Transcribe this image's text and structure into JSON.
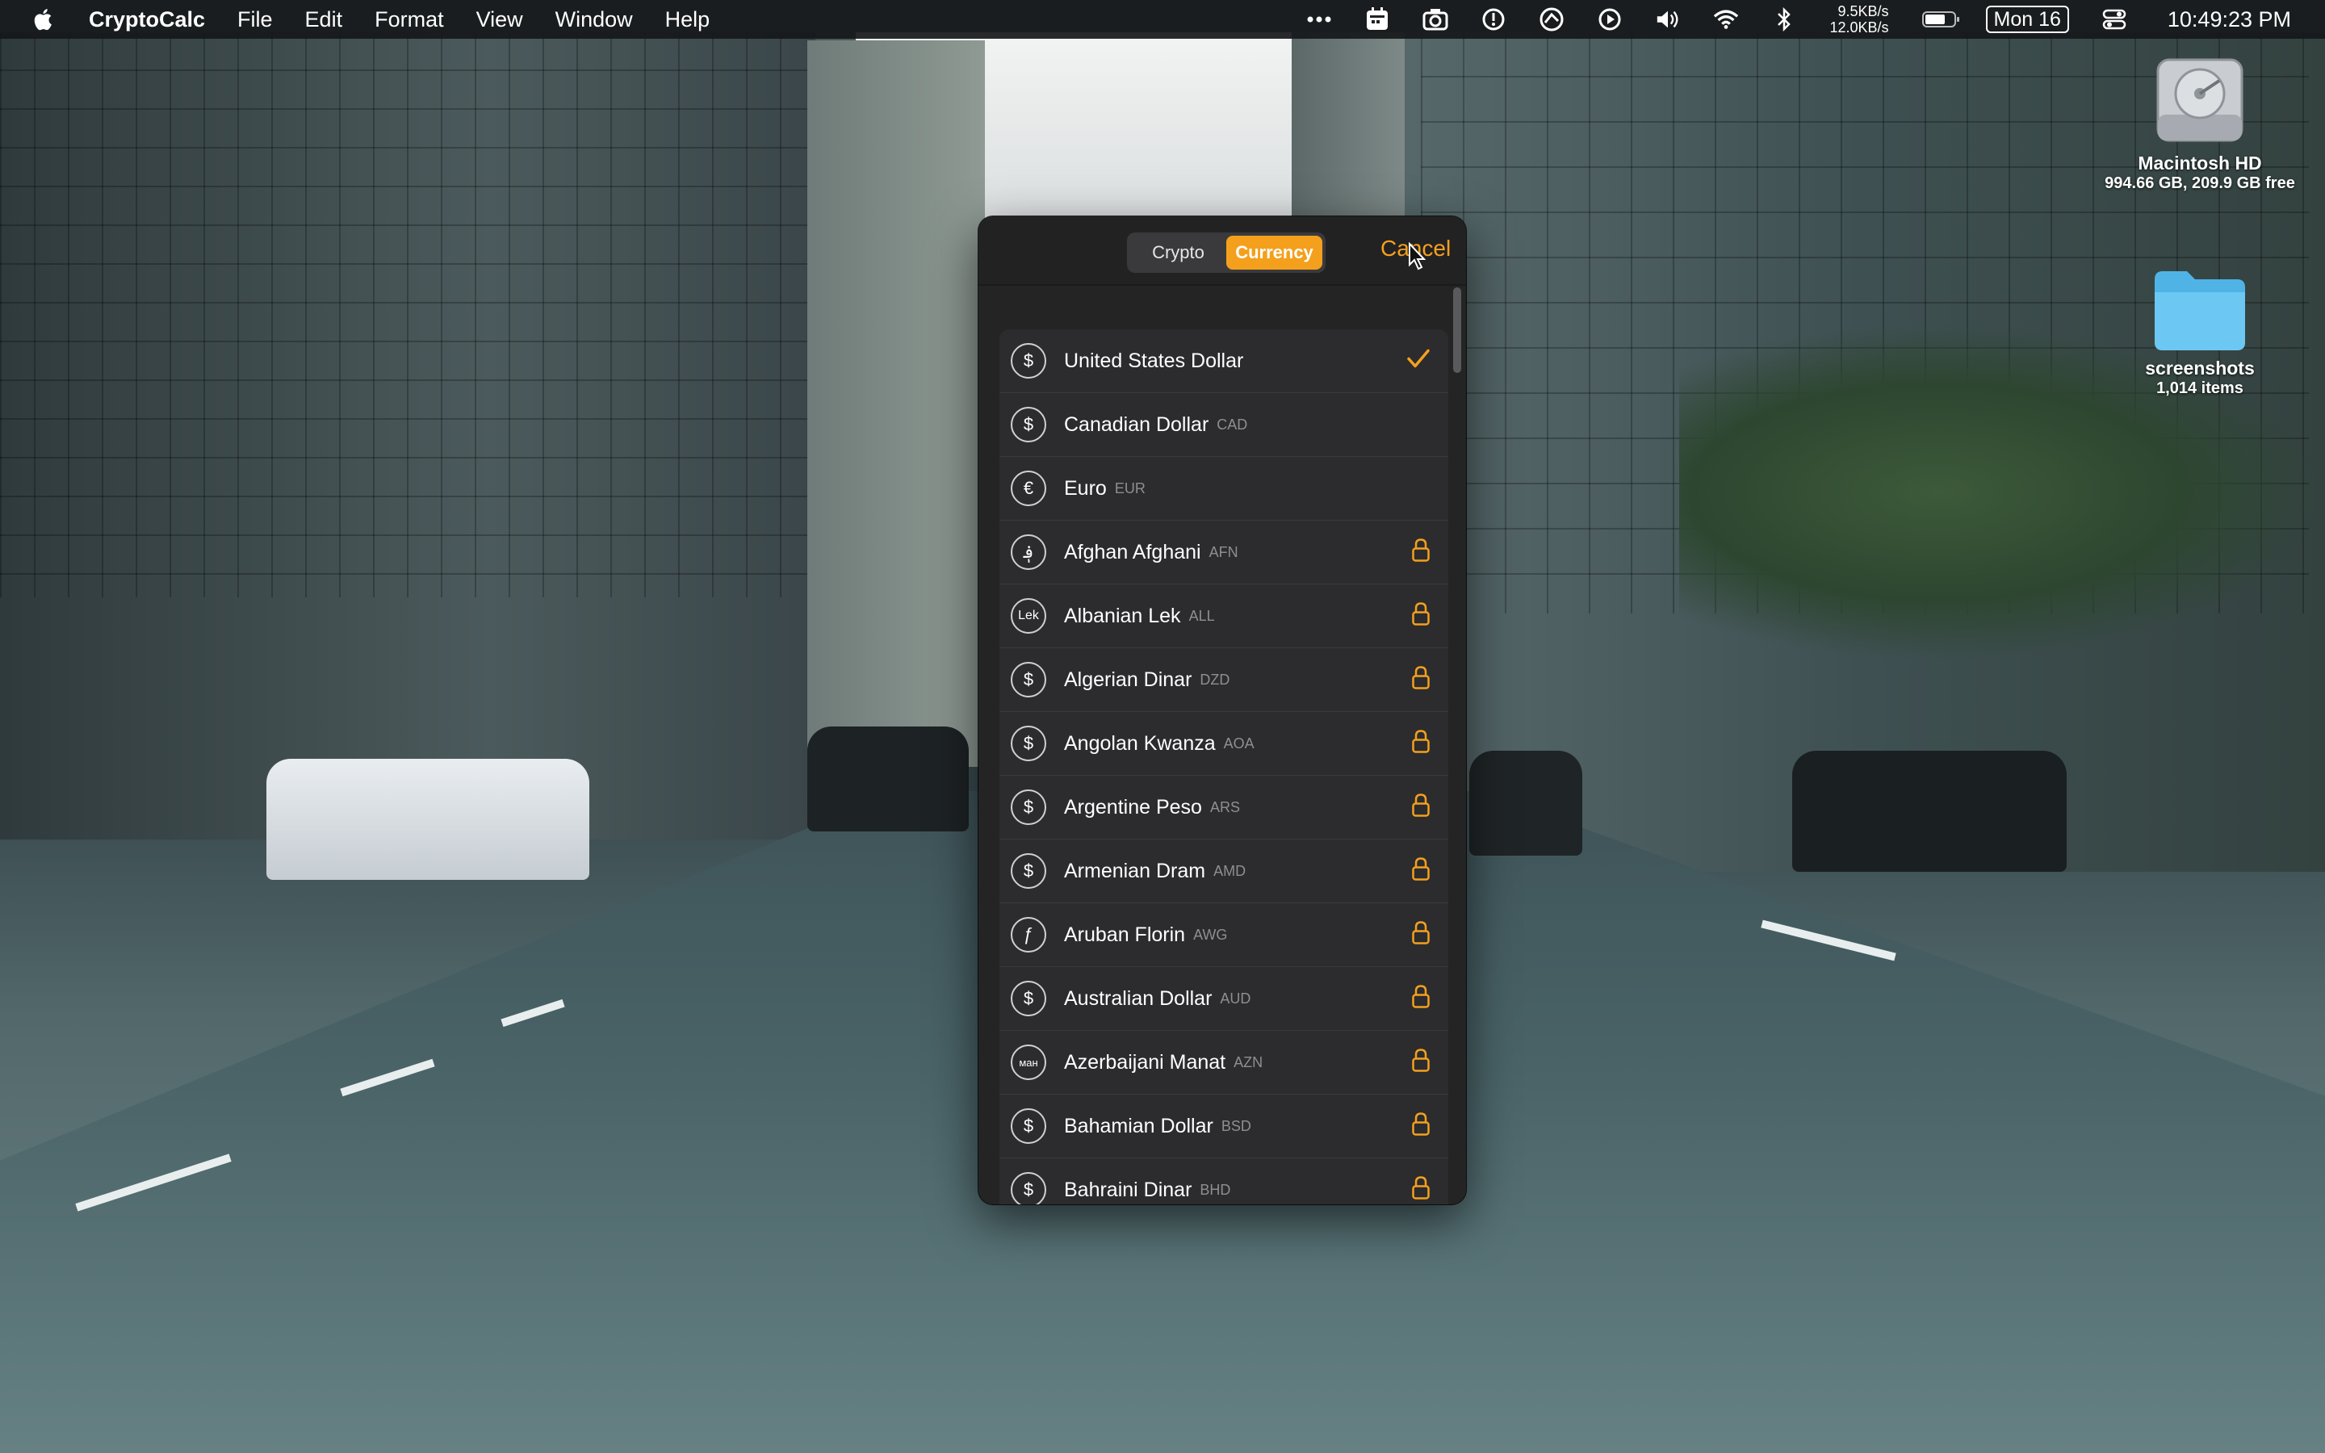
{
  "menubar": {
    "app_name": "CryptoCalc",
    "items": [
      "File",
      "Edit",
      "Format",
      "View",
      "Window",
      "Help"
    ],
    "net_up": "9.5KB/s",
    "net_down": "12.0KB/s",
    "date": "Mon 16",
    "time": "10:49:23 PM",
    "status_icons": [
      "more-icon",
      "calendar-icon",
      "camera-icon",
      "timer-icon",
      "vpn-icon",
      "play-icon",
      "volume-icon",
      "wifi-icon",
      "bluetooth-icon",
      "battery-icon",
      "control-center-icon"
    ]
  },
  "desktop": {
    "icons": [
      {
        "name": "Macintosh HD",
        "sub": "994.66 GB, 209.9 GB free",
        "icon": "hard-drive-icon"
      },
      {
        "name": "screenshots",
        "sub": "1,014 items",
        "icon": "folder-icon"
      }
    ]
  },
  "popover": {
    "segments": [
      "Crypto",
      "Currency"
    ],
    "selected_segment": "Currency",
    "cancel_label": "Cancel",
    "accent": "#f4a01d",
    "currencies": [
      {
        "symbol": "$",
        "name": "United States Dollar",
        "code": "",
        "state": "selected"
      },
      {
        "symbol": "$",
        "name": "Canadian Dollar",
        "code": "CAD",
        "state": "none"
      },
      {
        "symbol": "€",
        "name": "Euro",
        "code": "EUR",
        "state": "none"
      },
      {
        "symbol": "؋",
        "name": "Afghan Afghani",
        "code": "AFN",
        "state": "locked"
      },
      {
        "symbol": "Lek",
        "name": "Albanian Lek",
        "code": "ALL",
        "state": "locked"
      },
      {
        "symbol": "$",
        "name": "Algerian Dinar",
        "code": "DZD",
        "state": "locked"
      },
      {
        "symbol": "$",
        "name": "Angolan Kwanza",
        "code": "AOA",
        "state": "locked"
      },
      {
        "symbol": "$",
        "name": "Argentine Peso",
        "code": "ARS",
        "state": "locked"
      },
      {
        "symbol": "$",
        "name": "Armenian Dram",
        "code": "AMD",
        "state": "locked"
      },
      {
        "symbol": "ƒ",
        "name": "Aruban Florin",
        "code": "AWG",
        "state": "locked"
      },
      {
        "symbol": "$",
        "name": "Australian Dollar",
        "code": "AUD",
        "state": "locked"
      },
      {
        "symbol": "ман",
        "name": "Azerbaijani Manat",
        "code": "AZN",
        "state": "locked"
      },
      {
        "symbol": "$",
        "name": "Bahamian Dollar",
        "code": "BSD",
        "state": "locked"
      },
      {
        "symbol": "$",
        "name": "Bahraini Dinar",
        "code": "BHD",
        "state": "locked"
      }
    ]
  }
}
